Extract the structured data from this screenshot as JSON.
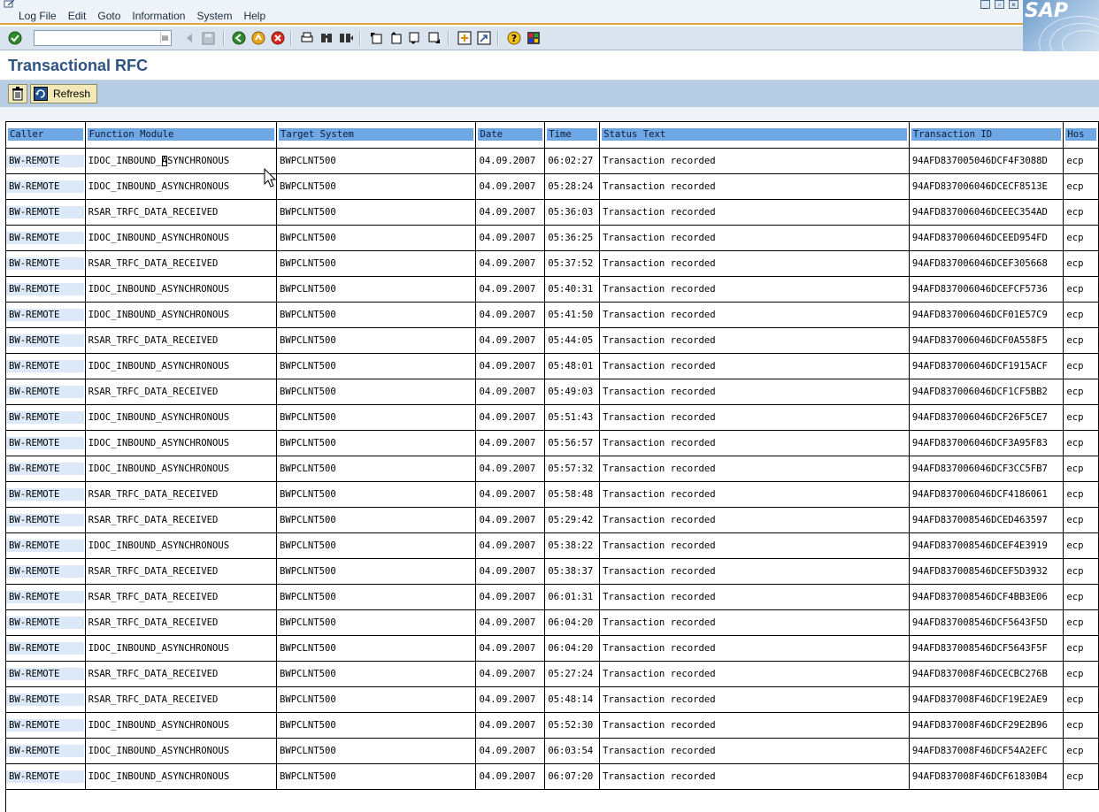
{
  "menu": {
    "items": [
      "Log File",
      "Edit",
      "Goto",
      "Information",
      "System",
      "Help"
    ]
  },
  "logo_text": "SAP",
  "toolbar": {
    "command_value": "",
    "icons": [
      "enter-icon",
      "back-icon",
      "exit-icon",
      "cancel-icon",
      "print-icon",
      "find-icon",
      "find-next-icon",
      "first-page-icon",
      "previous-page-icon",
      "next-page-icon",
      "last-page-icon",
      "create-session-icon",
      "shortcut-icon",
      "help-icon",
      "customize-layout-icon"
    ]
  },
  "title": "Transactional RFC",
  "app_toolbar": {
    "refresh_label": "Refresh"
  },
  "table": {
    "columns": [
      "Caller",
      "Function Module",
      "Target System",
      "Date",
      "Time",
      "Status Text",
      "Transaction ID",
      "Hos"
    ],
    "rows": [
      [
        "BW-REMOTE",
        "IDOC_INBOUND_ASYNCHRONOUS",
        "BWPCLNT500",
        "04.09.2007",
        "06:02:27",
        "Transaction recorded",
        "94AFD837005046DCF4F3088D",
        "ecp"
      ],
      [
        "BW-REMOTE",
        "IDOC_INBOUND_ASYNCHRONOUS",
        "BWPCLNT500",
        "04.09.2007",
        "05:28:24",
        "Transaction recorded",
        "94AFD837006046DCECF8513E",
        "ecp"
      ],
      [
        "BW-REMOTE",
        "RSAR_TRFC_DATA_RECEIVED",
        "BWPCLNT500",
        "04.09.2007",
        "05:36:03",
        "Transaction recorded",
        "94AFD837006046DCEEC354AD",
        "ecp"
      ],
      [
        "BW-REMOTE",
        "IDOC_INBOUND_ASYNCHRONOUS",
        "BWPCLNT500",
        "04.09.2007",
        "05:36:25",
        "Transaction recorded",
        "94AFD837006046DCEED954FD",
        "ecp"
      ],
      [
        "BW-REMOTE",
        "RSAR_TRFC_DATA_RECEIVED",
        "BWPCLNT500",
        "04.09.2007",
        "05:37:52",
        "Transaction recorded",
        "94AFD837006046DCEF305668",
        "ecp"
      ],
      [
        "BW-REMOTE",
        "IDOC_INBOUND_ASYNCHRONOUS",
        "BWPCLNT500",
        "04.09.2007",
        "05:40:31",
        "Transaction recorded",
        "94AFD837006046DCEFCF5736",
        "ecp"
      ],
      [
        "BW-REMOTE",
        "IDOC_INBOUND_ASYNCHRONOUS",
        "BWPCLNT500",
        "04.09.2007",
        "05:41:50",
        "Transaction recorded",
        "94AFD837006046DCF01E57C9",
        "ecp"
      ],
      [
        "BW-REMOTE",
        "RSAR_TRFC_DATA_RECEIVED",
        "BWPCLNT500",
        "04.09.2007",
        "05:44:05",
        "Transaction recorded",
        "94AFD837006046DCF0A558F5",
        "ecp"
      ],
      [
        "BW-REMOTE",
        "IDOC_INBOUND_ASYNCHRONOUS",
        "BWPCLNT500",
        "04.09.2007",
        "05:48:01",
        "Transaction recorded",
        "94AFD837006046DCF1915ACF",
        "ecp"
      ],
      [
        "BW-REMOTE",
        "RSAR_TRFC_DATA_RECEIVED",
        "BWPCLNT500",
        "04.09.2007",
        "05:49:03",
        "Transaction recorded",
        "94AFD837006046DCF1CF5BB2",
        "ecp"
      ],
      [
        "BW-REMOTE",
        "IDOC_INBOUND_ASYNCHRONOUS",
        "BWPCLNT500",
        "04.09.2007",
        "05:51:43",
        "Transaction recorded",
        "94AFD837006046DCF26F5CE7",
        "ecp"
      ],
      [
        "BW-REMOTE",
        "IDOC_INBOUND_ASYNCHRONOUS",
        "BWPCLNT500",
        "04.09.2007",
        "05:56:57",
        "Transaction recorded",
        "94AFD837006046DCF3A95F83",
        "ecp"
      ],
      [
        "BW-REMOTE",
        "IDOC_INBOUND_ASYNCHRONOUS",
        "BWPCLNT500",
        "04.09.2007",
        "05:57:32",
        "Transaction recorded",
        "94AFD837006046DCF3CC5FB7",
        "ecp"
      ],
      [
        "BW-REMOTE",
        "RSAR_TRFC_DATA_RECEIVED",
        "BWPCLNT500",
        "04.09.2007",
        "05:58:48",
        "Transaction recorded",
        "94AFD837006046DCF4186061",
        "ecp"
      ],
      [
        "BW-REMOTE",
        "RSAR_TRFC_DATA_RECEIVED",
        "BWPCLNT500",
        "04.09.2007",
        "05:29:42",
        "Transaction recorded",
        "94AFD837008546DCED463597",
        "ecp"
      ],
      [
        "BW-REMOTE",
        "IDOC_INBOUND_ASYNCHRONOUS",
        "BWPCLNT500",
        "04.09.2007",
        "05:38:22",
        "Transaction recorded",
        "94AFD837008546DCEF4E3919",
        "ecp"
      ],
      [
        "BW-REMOTE",
        "RSAR_TRFC_DATA_RECEIVED",
        "BWPCLNT500",
        "04.09.2007",
        "05:38:37",
        "Transaction recorded",
        "94AFD837008546DCEF5D3932",
        "ecp"
      ],
      [
        "BW-REMOTE",
        "RSAR_TRFC_DATA_RECEIVED",
        "BWPCLNT500",
        "04.09.2007",
        "06:01:31",
        "Transaction recorded",
        "94AFD837008546DCF4BB3E06",
        "ecp"
      ],
      [
        "BW-REMOTE",
        "RSAR_TRFC_DATA_RECEIVED",
        "BWPCLNT500",
        "04.09.2007",
        "06:04:20",
        "Transaction recorded",
        "94AFD837008546DCF5643F5D",
        "ecp"
      ],
      [
        "BW-REMOTE",
        "IDOC_INBOUND_ASYNCHRONOUS",
        "BWPCLNT500",
        "04.09.2007",
        "06:04:20",
        "Transaction recorded",
        "94AFD837008546DCF5643F5F",
        "ecp"
      ],
      [
        "BW-REMOTE",
        "RSAR_TRFC_DATA_RECEIVED",
        "BWPCLNT500",
        "04.09.2007",
        "05:27:24",
        "Transaction recorded",
        "94AFD837008F46DCECBC276B",
        "ecp"
      ],
      [
        "BW-REMOTE",
        "RSAR_TRFC_DATA_RECEIVED",
        "BWPCLNT500",
        "04.09.2007",
        "05:48:14",
        "Transaction recorded",
        "94AFD837008F46DCF19E2AE9",
        "ecp"
      ],
      [
        "BW-REMOTE",
        "IDOC_INBOUND_ASYNCHRONOUS",
        "BWPCLNT500",
        "04.09.2007",
        "05:52:30",
        "Transaction recorded",
        "94AFD837008F46DCF29E2B96",
        "ecp"
      ],
      [
        "BW-REMOTE",
        "IDOC_INBOUND_ASYNCHRONOUS",
        "BWPCLNT500",
        "04.09.2007",
        "06:03:54",
        "Transaction recorded",
        "94AFD837008F46DCF54A2EFC",
        "ecp"
      ],
      [
        "BW-REMOTE",
        "IDOC_INBOUND_ASYNCHRONOUS",
        "BWPCLNT500",
        "04.09.2007",
        "06:07:20",
        "Transaction recorded",
        "94AFD837008F46DCF61830B4",
        "ecp"
      ]
    ]
  },
  "colors": {
    "menu_bg": "#eef3f8",
    "accent_line": "#e8a040",
    "toolbar_bg": "#d9e4ef",
    "title_text": "#2e5581",
    "app_toolbar_bg": "#b7cde3",
    "header_cell_bg": "#6fa6e4",
    "caller_cell_bg": "#dbe9f8",
    "button_bg": "#f2e8b8"
  }
}
